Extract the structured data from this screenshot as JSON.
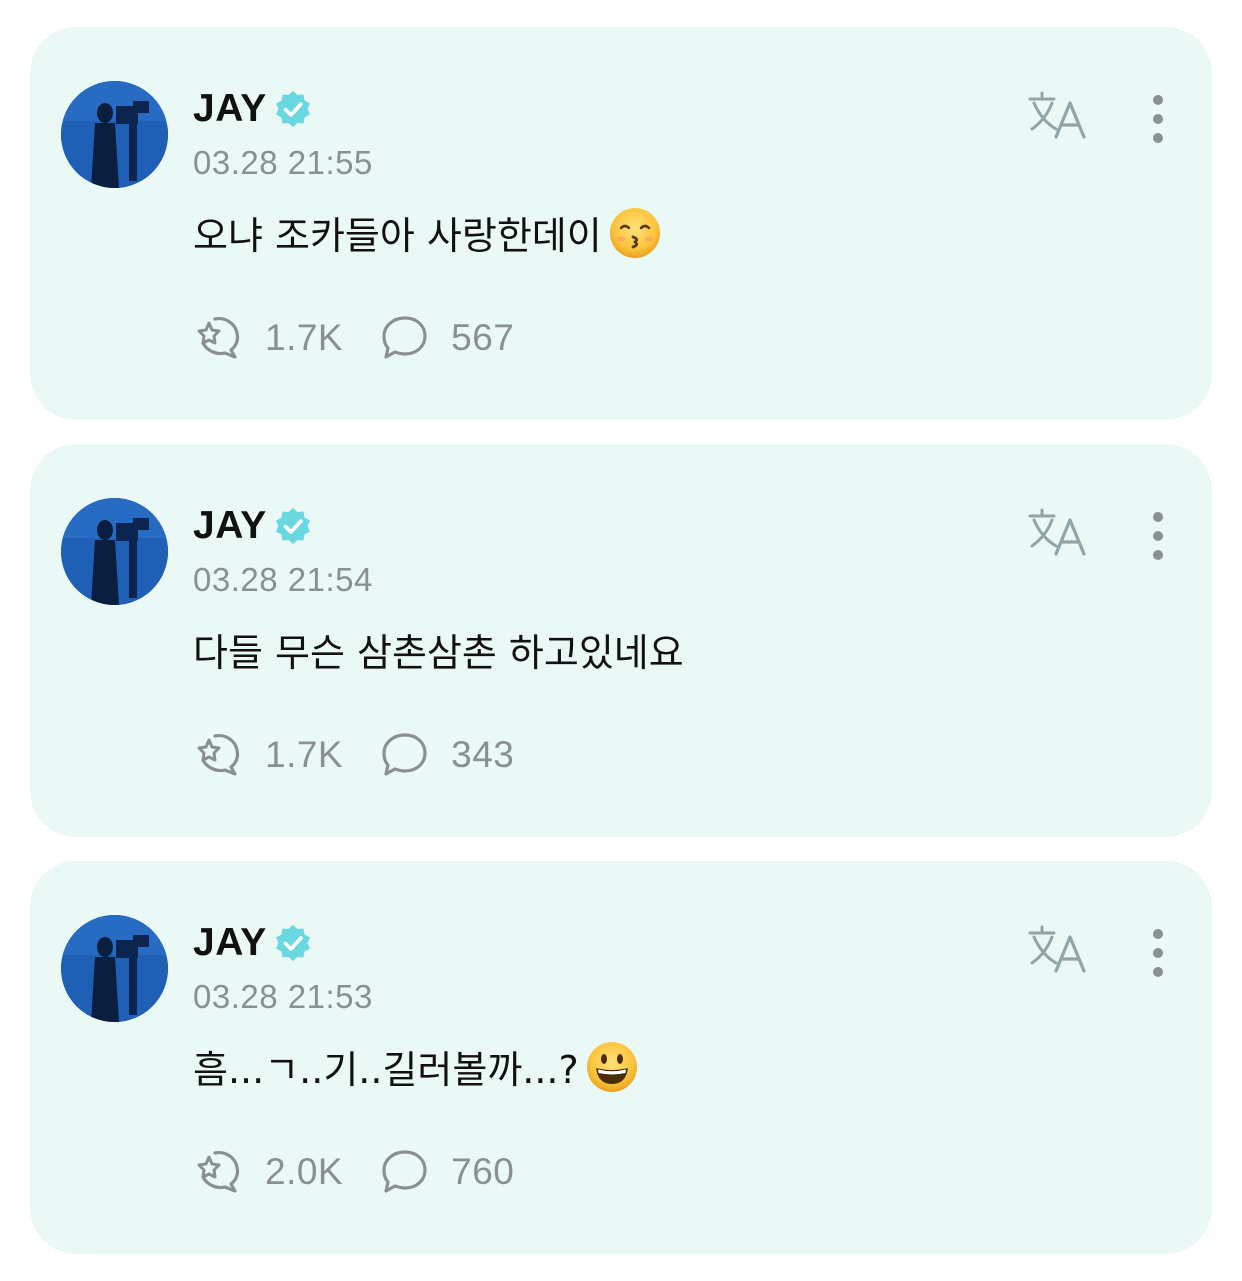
{
  "colors": {
    "card_background": "#ebf9f6",
    "verified_badge": "#6ad8e0",
    "muted_text": "#8a8f92",
    "primary_text": "#111111"
  },
  "icons": {
    "verified": "verified-badge-icon",
    "translate": "translate-icon",
    "more": "more-vertical-icon",
    "like": "star-sparkle-like-icon",
    "comment": "speech-bubble-comment-icon"
  },
  "posts": [
    {
      "author": "JAY",
      "verified": true,
      "timestamp": "03.28 21:55",
      "text": "오냐 조카들아 사랑한데이",
      "emoji": "kissing-face-emoji",
      "likes": "1.7K",
      "comments": "567"
    },
    {
      "author": "JAY",
      "verified": true,
      "timestamp": "03.28 21:54",
      "text": "다들 무슨 삼촌삼촌 하고있네요",
      "emoji": "",
      "likes": "1.7K",
      "comments": "343"
    },
    {
      "author": "JAY",
      "verified": true,
      "timestamp": "03.28 21:53",
      "text": "흠...ㄱ..기..길러볼까...?",
      "emoji": "grinning-face-emoji",
      "likes": "2.0K",
      "comments": "760"
    }
  ]
}
